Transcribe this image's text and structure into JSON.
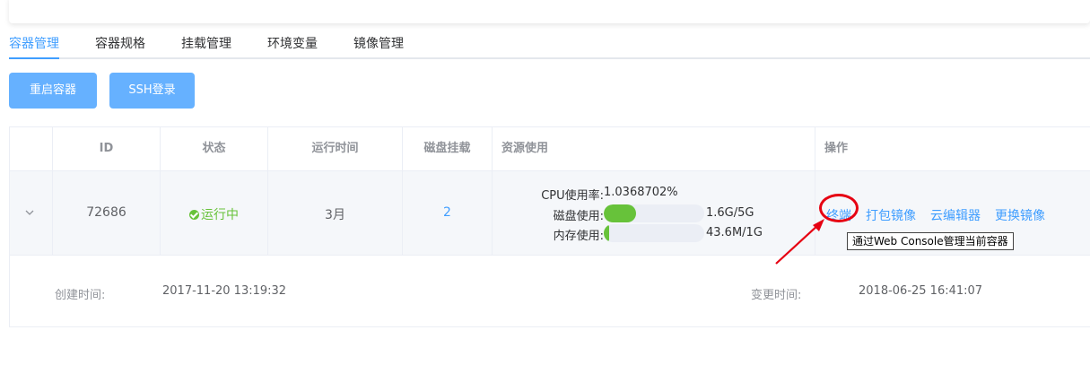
{
  "tabs": [
    {
      "label": "容器管理",
      "active": true
    },
    {
      "label": "容器规格"
    },
    {
      "label": "挂载管理"
    },
    {
      "label": "环境变量"
    },
    {
      "label": "镜像管理"
    }
  ],
  "toolbar": {
    "restart_label": "重启容器",
    "ssh_label": "SSH登录"
  },
  "table": {
    "headers": [
      "ID",
      "状态",
      "运行时间",
      "磁盘挂载",
      "资源使用",
      "操作"
    ],
    "row": {
      "id": "72686",
      "status": "运行中",
      "runtime": "3月",
      "disk_mounts": "2",
      "resources": {
        "cpu_label": "CPU使用率:",
        "cpu_value": "1.0368702%",
        "disk_label": "磁盘使用:",
        "disk_value": "1.6G/5G",
        "disk_fraction": 0.32,
        "mem_label": "内存使用:",
        "mem_value": "43.6M/1G",
        "mem_fraction": 0.04
      },
      "actions": {
        "terminal": "终端",
        "pack_image": "打包镜像",
        "cloud_editor": "云编辑器",
        "change_image": "更换镜像"
      },
      "tooltip": "通过Web Console管理当前容器"
    },
    "expanded": {
      "created_label": "创建时间:",
      "created_value": "2017-11-20 13:19:32",
      "changed_label": "变更时间:",
      "changed_value": "2018-06-25 16:41:07"
    }
  },
  "colors": {
    "primary": "#409eff",
    "success": "#67c23a",
    "annotation": "#e60012"
  },
  "icons": {
    "expand": "chevron-down-icon",
    "status": "check-circle-icon"
  }
}
